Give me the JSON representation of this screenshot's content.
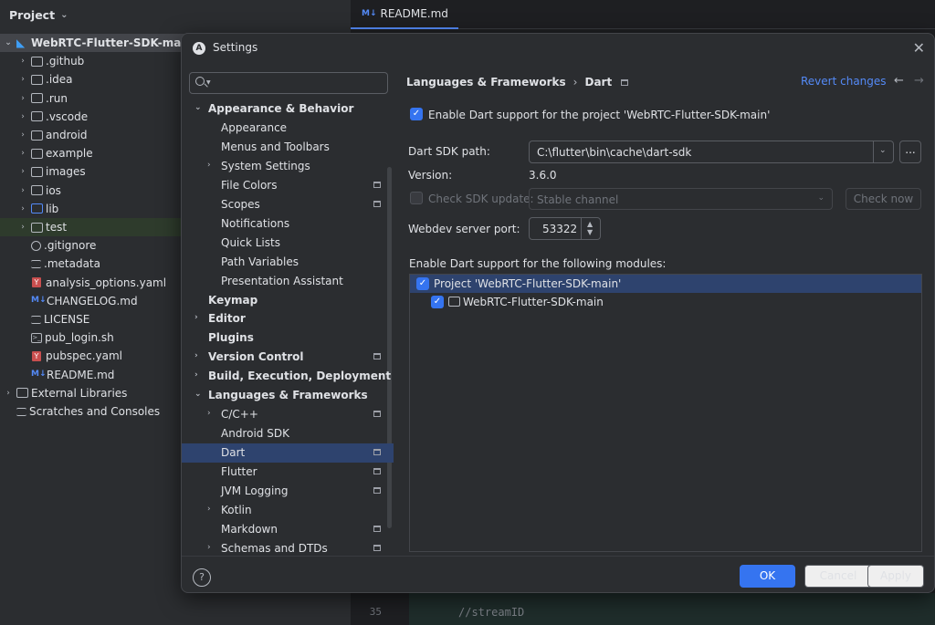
{
  "project": {
    "header": "Project",
    "tree": [
      {
        "label": "WebRTC-Flutter-SDK-main",
        "kind": "root"
      },
      {
        "label": ".github",
        "kind": "folder"
      },
      {
        "label": ".idea",
        "kind": "folder"
      },
      {
        "label": ".run",
        "kind": "folder"
      },
      {
        "label": ".vscode",
        "kind": "folder"
      },
      {
        "label": "android",
        "kind": "folder"
      },
      {
        "label": "example",
        "kind": "folder"
      },
      {
        "label": "images",
        "kind": "folder"
      },
      {
        "label": "ios",
        "kind": "folder"
      },
      {
        "label": "lib",
        "kind": "folder-blue"
      },
      {
        "label": "test",
        "kind": "folder-test"
      },
      {
        "label": ".gitignore",
        "kind": "gitignore"
      },
      {
        "label": ".metadata",
        "kind": "file"
      },
      {
        "label": "analysis_options.yaml",
        "kind": "yaml"
      },
      {
        "label": "CHANGELOG.md",
        "kind": "md"
      },
      {
        "label": "LICENSE",
        "kind": "file"
      },
      {
        "label": "pub_login.sh",
        "kind": "sh"
      },
      {
        "label": "pubspec.yaml",
        "kind": "yaml"
      },
      {
        "label": "README.md",
        "kind": "md"
      },
      {
        "label": "External Libraries",
        "kind": "libs"
      },
      {
        "label": "Scratches and Consoles",
        "kind": "scratches"
      }
    ]
  },
  "editor": {
    "tab_label": "README.md",
    "tab_icon": "M↓",
    "line_number": "35",
    "code_line": "//streamID"
  },
  "dialog": {
    "title": "Settings",
    "search": {
      "placeholder": "",
      "value": ""
    },
    "nav": [
      {
        "label": "Appearance & Behavior",
        "level": 0,
        "bold": true,
        "arrow": "open"
      },
      {
        "label": "Appearance",
        "level": 1
      },
      {
        "label": "Menus and Toolbars",
        "level": 1
      },
      {
        "label": "System Settings",
        "level": 1,
        "arrow": "closed"
      },
      {
        "label": "File Colors",
        "level": 1,
        "proj": true
      },
      {
        "label": "Scopes",
        "level": 1,
        "proj": true
      },
      {
        "label": "Notifications",
        "level": 1
      },
      {
        "label": "Quick Lists",
        "level": 1
      },
      {
        "label": "Path Variables",
        "level": 1
      },
      {
        "label": "Presentation Assistant",
        "level": 1
      },
      {
        "label": "Keymap",
        "level": 0,
        "bold": true
      },
      {
        "label": "Editor",
        "level": 0,
        "bold": true,
        "arrow": "closed"
      },
      {
        "label": "Plugins",
        "level": 0,
        "bold": true
      },
      {
        "label": "Version Control",
        "level": 0,
        "bold": true,
        "arrow": "closed",
        "proj": true
      },
      {
        "label": "Build, Execution, Deployment",
        "level": 0,
        "bold": true,
        "arrow": "closed"
      },
      {
        "label": "Languages & Frameworks",
        "level": 0,
        "bold": true,
        "arrow": "open"
      },
      {
        "label": "C/C++",
        "level": 1,
        "arrow": "closed",
        "proj": true
      },
      {
        "label": "Android SDK",
        "level": 1
      },
      {
        "label": "Dart",
        "level": 1,
        "proj": true,
        "selected": true
      },
      {
        "label": "Flutter",
        "level": 1,
        "proj": true
      },
      {
        "label": "JVM Logging",
        "level": 1,
        "proj": true
      },
      {
        "label": "Kotlin",
        "level": 1,
        "arrow": "closed"
      },
      {
        "label": "Markdown",
        "level": 1,
        "proj": true
      },
      {
        "label": "Schemas and DTDs",
        "level": 1,
        "arrow": "closed",
        "proj": true
      }
    ],
    "breadcrumb": {
      "parent": "Languages & Frameworks",
      "separator": "›",
      "current": "Dart"
    },
    "revert_label": "Revert changes",
    "enable_dart_label": "Enable Dart support for the project 'WebRTC-Flutter-SDK-main'",
    "sdk_path_label": "Dart SDK path:",
    "sdk_path_value": "C:\\flutter\\bin\\cache\\dart-sdk",
    "browse_label": "...",
    "version_label": "Version:",
    "version_value": "3.6.0",
    "check_update_label": "Check SDK update:",
    "channel_value": "Stable channel",
    "check_now_label": "Check now",
    "webdev_port_label": "Webdev server port:",
    "webdev_port_value": "53322",
    "modules_label": "Enable Dart support for the following modules:",
    "modules": {
      "project_row": "Project 'WebRTC-Flutter-SDK-main'",
      "module_row": "WebRTC-Flutter-SDK-main"
    },
    "help_label": "?",
    "ok_label": "OK",
    "cancel_label": "Cancel",
    "apply_label": "Apply"
  },
  "colors": {
    "accent": "#3574f0",
    "selection": "#2e436e",
    "link": "#548af7"
  }
}
